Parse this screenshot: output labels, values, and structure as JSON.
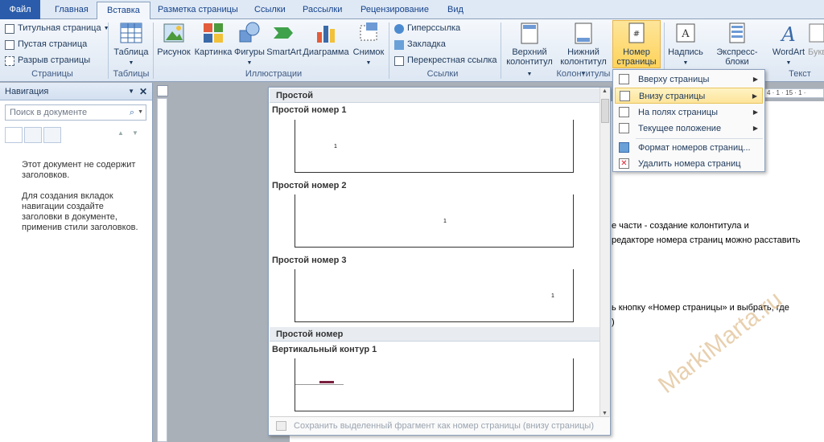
{
  "tabs": [
    "Файл",
    "Главная",
    "Вставка",
    "Разметка страницы",
    "Ссылки",
    "Рассылки",
    "Рецензирование",
    "Вид"
  ],
  "ribbon": {
    "pages": {
      "title_page": "Титульная страница",
      "blank_page": "Пустая страница",
      "page_break": "Разрыв страницы",
      "label": "Страницы"
    },
    "tables": {
      "table": "Таблица",
      "label": "Таблицы"
    },
    "illustrations": {
      "picture": "Рисунок",
      "clipart": "Картинка",
      "shapes": "Фигуры",
      "smartart": "SmartArt",
      "chart": "Диаграмма",
      "screenshot": "Снимок",
      "label": "Иллюстрации"
    },
    "links": {
      "hyperlink": "Гиперссылка",
      "bookmark": "Закладка",
      "crossref": "Перекрестная ссылка",
      "label": "Ссылки"
    },
    "headers": {
      "header_1": "Верхний",
      "header_2": "колонтитул",
      "footer_1": "Нижний",
      "footer_2": "колонтитул",
      "page_number_1": "Номер",
      "page_number_2": "страницы",
      "label": "Колонтитулы"
    },
    "text": {
      "textbox": "Надпись",
      "quickparts": "Экспресс-блоки",
      "wordart": "WordArt",
      "dropcap": "Букв",
      "label": "Текст"
    }
  },
  "navigation": {
    "title": "Навигация",
    "search_placeholder": "Поиск в документе",
    "message_1": "Этот документ не содержит заголовков.",
    "message_2": "Для создания вкладок навигации создайте заголовки в документе, применив стили заголовков."
  },
  "ruler": {
    "marks": "4 · 1 · 15 · 1 ·"
  },
  "document": {
    "line1": "е части - создание колонтитула и",
    "line2": "редакторе номера страниц можно расставить",
    "line3": "ь кнопку  «Номер страницы» и  выбрать, где",
    "line4": ")"
  },
  "gallery": {
    "section1": "Простой",
    "item1": "Простой номер 1",
    "item2": "Простой номер 2",
    "item3": "Простой номер 3",
    "section2": "Простой номер",
    "item4": "Вертикальный контур 1",
    "sample_number": "1",
    "footer": "Сохранить выделенный фрагмент как номер страницы (внизу страницы)"
  },
  "menu": {
    "top": "Вверху страницы",
    "bottom": "Внизу страницы",
    "margins": "На полях страницы",
    "current": "Текущее положение",
    "format": "Формат номеров страниц...",
    "remove": "Удалить номера страниц"
  },
  "watermark": "MarkiMarta.ru",
  "colors": {
    "accent": "#2a5cab",
    "highlight": "#fde49a",
    "ribbon_bg": "#dde7f3"
  }
}
